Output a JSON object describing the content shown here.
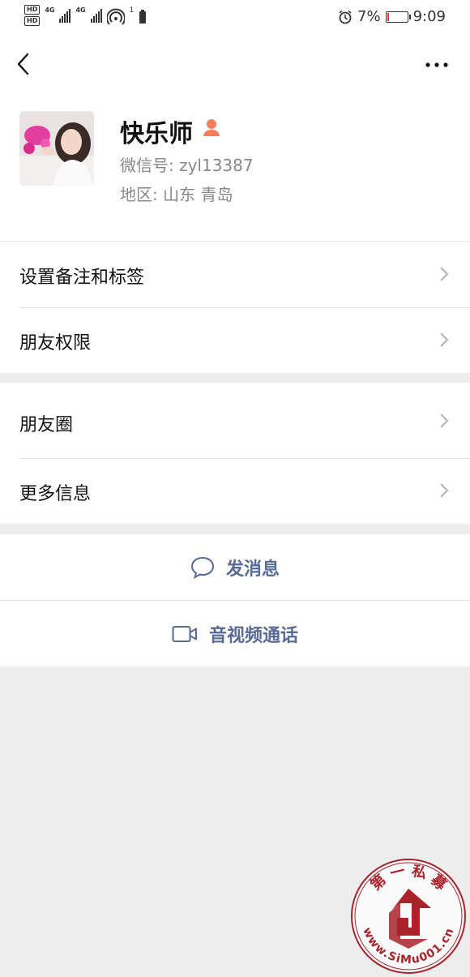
{
  "status_bar": {
    "sim1": "HD",
    "sim2": "HD",
    "net1": "4G",
    "net2": "4G",
    "hotspot_count": "1",
    "battery_percent": "7%",
    "battery_level": 0.07,
    "time": "9:09",
    "icons": [
      "alarm-icon",
      "battery-icon",
      "signal-icon",
      "hotspot-icon"
    ]
  },
  "nav": {
    "back_icon": "chevron-left-icon",
    "more_icon": "more-dots-icon"
  },
  "profile": {
    "nickname": "快乐师",
    "wechat_id": "微信号: zyl13387",
    "region": "地区: 山东  青岛",
    "gender_icon": "female-user-icon",
    "gender_color": "#f37e5b"
  },
  "groups": [
    {
      "items": [
        {
          "label": "设置备注和标签"
        },
        {
          "label": "朋友权限"
        }
      ]
    },
    {
      "items": [
        {
          "label": "朋友圈"
        },
        {
          "label": "更多信息"
        }
      ]
    }
  ],
  "actions": [
    {
      "label": "发消息",
      "icon": "chat-bubble-icon"
    },
    {
      "label": "音视频通话",
      "icon": "video-call-icon"
    }
  ],
  "watermark": {
    "text_top": "第 一 私 募",
    "text_bottom": "www.SiMu001.cn"
  },
  "colors": {
    "link": "#576b95",
    "background": "#ededed",
    "stamp": "#a8232a"
  }
}
